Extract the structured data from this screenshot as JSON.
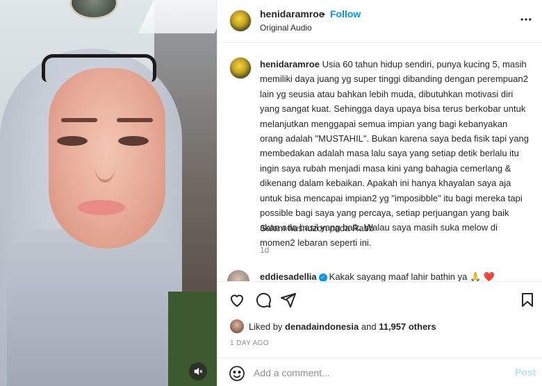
{
  "header": {
    "username": "henidaramroe",
    "separator": "•",
    "follow_label": "Follow",
    "audio_label": "Original Audio",
    "more_icon": "more-horizontal-icon"
  },
  "caption": {
    "username": "henidaramroe",
    "text": "Usia 60 tahun hidup sendiri, punya kucing 5, masih memiliki daya juang yg super tinggi dibanding dengan perempuan2 lain yg seusia atau bahkan lebih muda, dibutuhkan motivasi diri yang sangat kuat. Sehingga daya upaya bisa terus berkobar untuk melanjutkan menggapai semua impian yang bagi kebanyakan orang adalah \"MUSTAHIL\". Bukan karena saya beda fisik tapi yang membedakan adalah masa lalu saya yang setiap detik berlalu itu ingin saya rubah menjadi masa kini yang bahagia cemerlang & dikenang dalam kebaikan. Apakah ini hanya khayalan saya aja untuk bisa mencapai impian2 yg \"imposibble\" itu bagi mereka tapi possible bagi saya yang percaya, setiap perjuangan yang baik akan ada hasil yang baik. Walau saya masih suka melow di momen2 lebaran seperti ini.",
    "closing": "Salam husnuzon pada Rabb",
    "age": "1d"
  },
  "comment": {
    "username": "eddiesadellia",
    "text": "Kakak sayang maaf lahir bathin ya",
    "emoji_pray": "🙏",
    "emoji_heart": "❤️"
  },
  "actions": {
    "like_icon": "heart-icon",
    "comment_icon": "comment-icon",
    "share_icon": "send-icon",
    "save_icon": "bookmark-icon"
  },
  "likes": {
    "prefix": "Liked by",
    "liker": "denadaindonesia",
    "and": "and",
    "count": "11,957 others"
  },
  "timestamp": "1 DAY AGO",
  "add_comment": {
    "placeholder": "Add a comment...",
    "post_label": "Post",
    "emoji_icon": "smiley-icon"
  },
  "video": {
    "mute_icon": "speaker-muted-icon"
  },
  "colors": {
    "accent": "#0095f6",
    "post_disabled": "#b2dffc",
    "muted_text": "#8e8e8e"
  }
}
